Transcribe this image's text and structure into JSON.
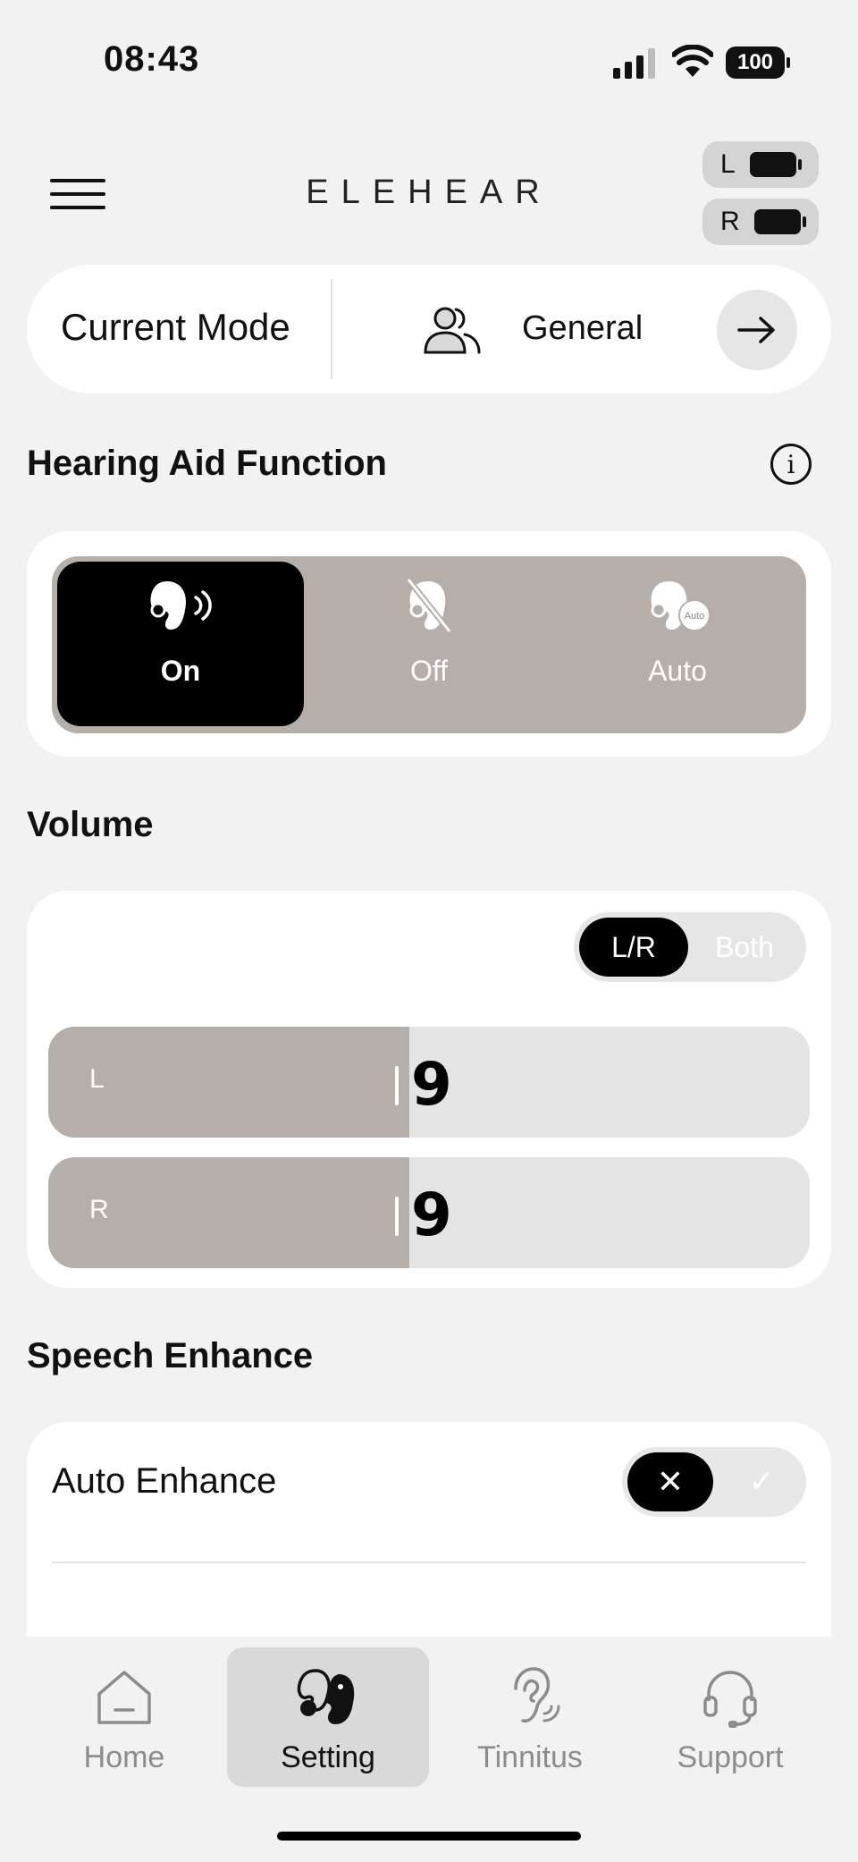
{
  "status_bar": {
    "time": "08:43",
    "battery": "100"
  },
  "header": {
    "logo": "ELEHEAR",
    "left_label": "L",
    "right_label": "R"
  },
  "mode": {
    "label": "Current Mode",
    "name": "General"
  },
  "hearing_aid": {
    "title": "Hearing Aid Function",
    "options": [
      {
        "label": "On",
        "icon": "hearing-aid-sound-icon",
        "selected": true
      },
      {
        "label": "Off",
        "icon": "hearing-aid-off-icon",
        "selected": false
      },
      {
        "label": "Auto",
        "icon": "hearing-aid-auto-icon",
        "selected": false
      }
    ],
    "auto_badge": "Auto"
  },
  "volume": {
    "title": "Volume",
    "mode_options": [
      "L/R",
      "Both"
    ],
    "selected_mode": "L/R",
    "left": {
      "label": "L",
      "value": "9"
    },
    "right": {
      "label": "R",
      "value": "9"
    },
    "fill_fraction": 0.474
  },
  "speech_enhance": {
    "title": "Speech Enhance",
    "auto_enhance_label": "Auto Enhance",
    "auto_enhance_on": false,
    "off_symbol": "✕",
    "on_symbol": "✓"
  },
  "tabs": [
    {
      "label": "Home",
      "icon": "home-icon",
      "active": false
    },
    {
      "label": "Setting",
      "icon": "hearing-aids-icon",
      "active": true
    },
    {
      "label": "Tinnitus",
      "icon": "ear-icon",
      "active": false
    },
    {
      "label": "Support",
      "icon": "headset-icon",
      "active": false
    }
  ]
}
